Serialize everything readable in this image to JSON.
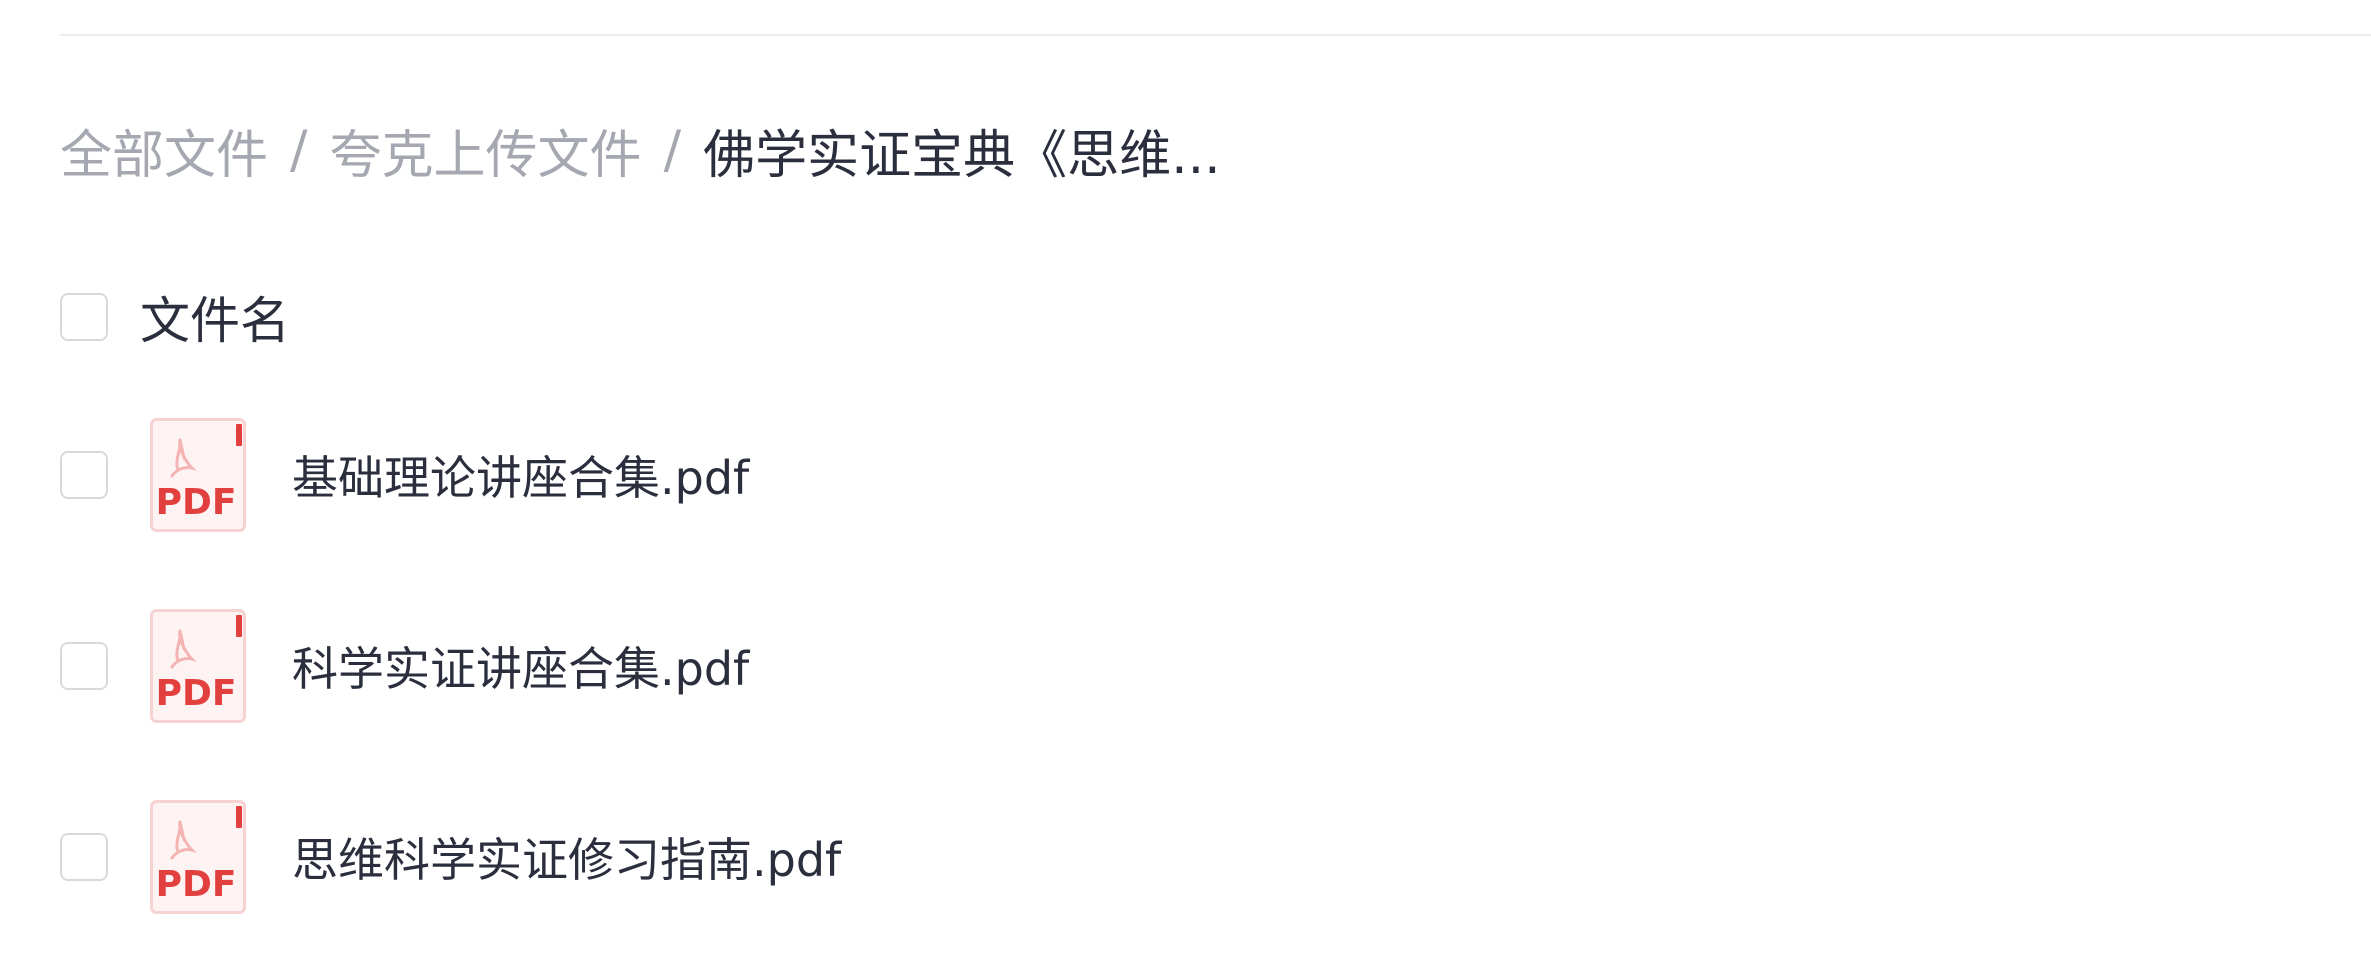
{
  "breadcrumb": {
    "items": [
      {
        "label": "全部文件"
      },
      {
        "label": "夸克上传文件"
      }
    ],
    "separator": "/",
    "current": "佛学实证宝典《思维..."
  },
  "list": {
    "header": {
      "name_label": "文件名"
    },
    "files": [
      {
        "name": "基础理论讲座合集.pdf",
        "icon": "pdf-file-icon"
      },
      {
        "name": "科学实证讲座合集.pdf",
        "icon": "pdf-file-icon"
      },
      {
        "name": "思维科学实证修习指南.pdf",
        "icon": "pdf-file-icon"
      }
    ]
  },
  "pdf_icon": {
    "badge_text": "PDF",
    "accent_color": "#e2403f",
    "body_color": "#fdf3f3"
  }
}
